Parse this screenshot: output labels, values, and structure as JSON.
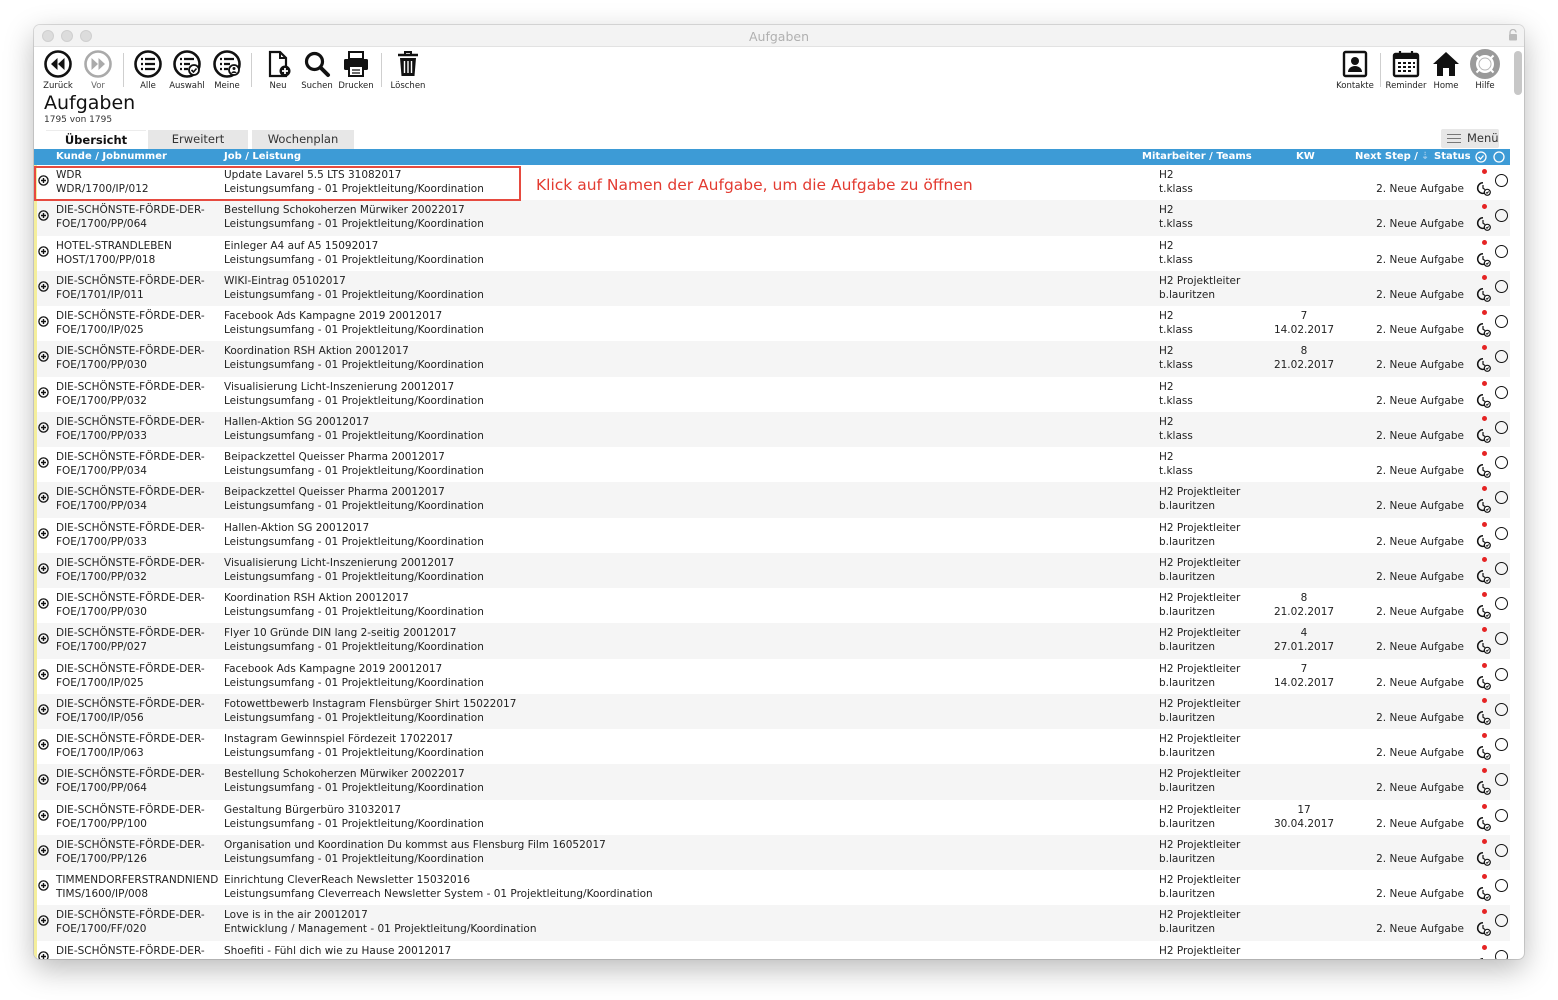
{
  "window": {
    "title": "Aufgaben"
  },
  "toolbar": {
    "left": [
      {
        "label": "Zurück",
        "icon": "back-icon"
      },
      {
        "label": "Vor",
        "icon": "forward-icon"
      },
      {
        "label": "Alle",
        "icon": "list-all-icon"
      },
      {
        "label": "Auswahl",
        "icon": "list-selection-icon"
      },
      {
        "label": "Meine",
        "icon": "list-mine-icon"
      },
      {
        "label": "Neu",
        "icon": "new-document-icon"
      },
      {
        "label": "Suchen",
        "icon": "search-icon"
      },
      {
        "label": "Drucken",
        "icon": "printer-icon"
      },
      {
        "label": "Löschen",
        "icon": "trash-icon"
      }
    ],
    "right": [
      {
        "label": "Kontakte",
        "icon": "contacts-icon"
      },
      {
        "label": "Reminder",
        "icon": "calendar-icon"
      },
      {
        "label": "Home",
        "icon": "home-icon"
      },
      {
        "label": "Hilfe",
        "icon": "help-icon"
      }
    ]
  },
  "page": {
    "title": "Aufgaben",
    "count": "1795 von 1795"
  },
  "tabs": [
    {
      "label": "Übersicht",
      "active": true
    },
    {
      "label": "Erweitert",
      "active": false
    },
    {
      "label": "Wochenplan",
      "active": false
    }
  ],
  "menu_label": "Menü",
  "columns": {
    "kunde": "Kunde / Jobnummer",
    "job": "Job / Leistung",
    "mitarbeiter": "Mitarbeiter / Teams",
    "kw": "KW",
    "next": "Next Step / ",
    "status": "Status"
  },
  "colors": {
    "header": "#3d9bd6",
    "stripe": "#f4ee9c",
    "highlight": "#e64a3f",
    "dot": "#e52424"
  },
  "annotation": "Klick auf Namen der Aufgabe, um die Aufgabe zu öffnen",
  "rows": [
    {
      "kunde": "WDR",
      "jobnr": "WDR/1700/IP/012",
      "job": "Update Lavarel 5.5 LTS 31082017",
      "leistung": "Leistungsumfang - 01 Projektleitung/Koordination",
      "team": "H2",
      "mitarbeiter": "t.klass",
      "kw": "",
      "datum": "",
      "next": "2. Neue Aufgabe"
    },
    {
      "kunde": "DIE-SCHÖNSTE-FÖRDE-DER-",
      "jobnr": "FOE/1700/PP/064",
      "job": "Bestellung Schokoherzen Mürwiker 20022017",
      "leistung": "Leistungsumfang - 01 Projektleitung/Koordination",
      "team": "H2",
      "mitarbeiter": "t.klass",
      "kw": "",
      "datum": "",
      "next": "2. Neue Aufgabe"
    },
    {
      "kunde": "HOTEL-STRANDLEBEN",
      "jobnr": "HOST/1700/PP/018",
      "job": "Einleger A4 auf A5 15092017",
      "leistung": "Leistungsumfang - 01 Projektleitung/Koordination",
      "team": "H2",
      "mitarbeiter": "t.klass",
      "kw": "",
      "datum": "",
      "next": "2. Neue Aufgabe"
    },
    {
      "kunde": "DIE-SCHÖNSTE-FÖRDE-DER-",
      "jobnr": "FOE/1701/IP/011",
      "job": "WIKI-Eintrag 05102017",
      "leistung": "Leistungsumfang - 01 Projektleitung/Koordination",
      "team": "H2 Projektleiter",
      "mitarbeiter": "b.lauritzen",
      "kw": "",
      "datum": "",
      "next": "2. Neue Aufgabe"
    },
    {
      "kunde": "DIE-SCHÖNSTE-FÖRDE-DER-",
      "jobnr": "FOE/1700/IP/025",
      "job": "Facebook Ads Kampagne 2019 20012017",
      "leistung": "Leistungsumfang - 01 Projektleitung/Koordination",
      "team": "H2",
      "mitarbeiter": "t.klass",
      "kw": "7",
      "datum": "14.02.2017",
      "next": "2. Neue Aufgabe"
    },
    {
      "kunde": "DIE-SCHÖNSTE-FÖRDE-DER-",
      "jobnr": "FOE/1700/PP/030",
      "job": "Koordination RSH Aktion 20012017",
      "leistung": "Leistungsumfang - 01 Projektleitung/Koordination",
      "team": "H2",
      "mitarbeiter": "t.klass",
      "kw": "8",
      "datum": "21.02.2017",
      "next": "2. Neue Aufgabe"
    },
    {
      "kunde": "DIE-SCHÖNSTE-FÖRDE-DER-",
      "jobnr": "FOE/1700/PP/032",
      "job": "Visualisierung Licht-Inszenierung 20012017",
      "leistung": "Leistungsumfang - 01 Projektleitung/Koordination",
      "team": "H2",
      "mitarbeiter": "t.klass",
      "kw": "",
      "datum": "",
      "next": "2. Neue Aufgabe"
    },
    {
      "kunde": "DIE-SCHÖNSTE-FÖRDE-DER-",
      "jobnr": "FOE/1700/PP/033",
      "job": "Hallen-Aktion SG 20012017",
      "leistung": "Leistungsumfang - 01 Projektleitung/Koordination",
      "team": "H2",
      "mitarbeiter": "t.klass",
      "kw": "",
      "datum": "",
      "next": "2. Neue Aufgabe"
    },
    {
      "kunde": "DIE-SCHÖNSTE-FÖRDE-DER-",
      "jobnr": "FOE/1700/PP/034",
      "job": "Beipackzettel Queisser Pharma 20012017",
      "leistung": "Leistungsumfang - 01 Projektleitung/Koordination",
      "team": "H2",
      "mitarbeiter": "t.klass",
      "kw": "",
      "datum": "",
      "next": "2. Neue Aufgabe"
    },
    {
      "kunde": "DIE-SCHÖNSTE-FÖRDE-DER-",
      "jobnr": "FOE/1700/PP/034",
      "job": "Beipackzettel Queisser Pharma 20012017",
      "leistung": "Leistungsumfang - 01 Projektleitung/Koordination",
      "team": "H2 Projektleiter",
      "mitarbeiter": "b.lauritzen",
      "kw": "",
      "datum": "",
      "next": "2. Neue Aufgabe"
    },
    {
      "kunde": "DIE-SCHÖNSTE-FÖRDE-DER-",
      "jobnr": "FOE/1700/PP/033",
      "job": "Hallen-Aktion SG 20012017",
      "leistung": "Leistungsumfang - 01 Projektleitung/Koordination",
      "team": "H2 Projektleiter",
      "mitarbeiter": "b.lauritzen",
      "kw": "",
      "datum": "",
      "next": "2. Neue Aufgabe"
    },
    {
      "kunde": "DIE-SCHÖNSTE-FÖRDE-DER-",
      "jobnr": "FOE/1700/PP/032",
      "job": "Visualisierung Licht-Inszenierung 20012017",
      "leistung": "Leistungsumfang - 01 Projektleitung/Koordination",
      "team": "H2 Projektleiter",
      "mitarbeiter": "b.lauritzen",
      "kw": "",
      "datum": "",
      "next": "2. Neue Aufgabe"
    },
    {
      "kunde": "DIE-SCHÖNSTE-FÖRDE-DER-",
      "jobnr": "FOE/1700/PP/030",
      "job": "Koordination RSH Aktion 20012017",
      "leistung": "Leistungsumfang - 01 Projektleitung/Koordination",
      "team": "H2 Projektleiter",
      "mitarbeiter": "b.lauritzen",
      "kw": "8",
      "datum": "21.02.2017",
      "next": "2. Neue Aufgabe"
    },
    {
      "kunde": "DIE-SCHÖNSTE-FÖRDE-DER-",
      "jobnr": "FOE/1700/PP/027",
      "job": "Flyer 10 Gründe DIN lang 2-seitig 20012017",
      "leistung": "Leistungsumfang - 01 Projektleitung/Koordination",
      "team": "H2 Projektleiter",
      "mitarbeiter": "b.lauritzen",
      "kw": "4",
      "datum": "27.01.2017",
      "next": "2. Neue Aufgabe"
    },
    {
      "kunde": "DIE-SCHÖNSTE-FÖRDE-DER-",
      "jobnr": "FOE/1700/IP/025",
      "job": "Facebook Ads Kampagne 2019 20012017",
      "leistung": "Leistungsumfang - 01 Projektleitung/Koordination",
      "team": "H2 Projektleiter",
      "mitarbeiter": "b.lauritzen",
      "kw": "7",
      "datum": "14.02.2017",
      "next": "2. Neue Aufgabe"
    },
    {
      "kunde": "DIE-SCHÖNSTE-FÖRDE-DER-",
      "jobnr": "FOE/1700/IP/056",
      "job": "Fotowettbewerb Instagram Flensbürger Shirt 15022017",
      "leistung": "Leistungsumfang - 01 Projektleitung/Koordination",
      "team": "H2 Projektleiter",
      "mitarbeiter": "b.lauritzen",
      "kw": "",
      "datum": "",
      "next": "2. Neue Aufgabe"
    },
    {
      "kunde": "DIE-SCHÖNSTE-FÖRDE-DER-",
      "jobnr": "FOE/1700/IP/063",
      "job": "Instagram Gewinnspiel Fördezeit 17022017",
      "leistung": "Leistungsumfang - 01 Projektleitung/Koordination",
      "team": "H2 Projektleiter",
      "mitarbeiter": "b.lauritzen",
      "kw": "",
      "datum": "",
      "next": "2. Neue Aufgabe"
    },
    {
      "kunde": "DIE-SCHÖNSTE-FÖRDE-DER-",
      "jobnr": "FOE/1700/PP/064",
      "job": "Bestellung Schokoherzen Mürwiker 20022017",
      "leistung": "Leistungsumfang - 01 Projektleitung/Koordination",
      "team": "H2 Projektleiter",
      "mitarbeiter": "b.lauritzen",
      "kw": "",
      "datum": "",
      "next": "2. Neue Aufgabe"
    },
    {
      "kunde": "DIE-SCHÖNSTE-FÖRDE-DER-",
      "jobnr": "FOE/1700/PP/100",
      "job": "Gestaltung Bürgerbüro 31032017",
      "leistung": "Leistungsumfang - 01 Projektleitung/Koordination",
      "team": "H2 Projektleiter",
      "mitarbeiter": "b.lauritzen",
      "kw": "17",
      "datum": "30.04.2017",
      "next": "2. Neue Aufgabe"
    },
    {
      "kunde": "DIE-SCHÖNSTE-FÖRDE-DER-",
      "jobnr": "FOE/1700/PP/126",
      "job": "Organisation und Koordination Du kommst aus Flensburg Film 16052017",
      "leistung": "Leistungsumfang - 01 Projektleitung/Koordination",
      "team": "H2 Projektleiter",
      "mitarbeiter": "b.lauritzen",
      "kw": "",
      "datum": "",
      "next": "2. Neue Aufgabe"
    },
    {
      "kunde": "TIMMENDORFERSTRANDNIEND",
      "jobnr": "TIMS/1600/IP/008",
      "job": "Einrichtung CleverReach Newsletter 15032016",
      "leistung": "Leistungsumfang Cleverreach Newsletter System - 01 Projektleitung/Koordination",
      "team": "H2 Projektleiter",
      "mitarbeiter": "b.lauritzen",
      "kw": "",
      "datum": "",
      "next": "2. Neue Aufgabe"
    },
    {
      "kunde": "DIE-SCHÖNSTE-FÖRDE-DER-",
      "jobnr": "FOE/1700/FF/020",
      "job": "Love is in the air 20012017",
      "leistung": "Entwicklung / Management - 01 Projektleitung/Koordination",
      "team": "H2 Projektleiter",
      "mitarbeiter": "b.lauritzen",
      "kw": "",
      "datum": "",
      "next": "2. Neue Aufgabe"
    },
    {
      "kunde": "DIE-SCHÖNSTE-FÖRDE-DER-",
      "jobnr": "",
      "job": "Shoefiti - Fühl dich wie zu Hause 20012017",
      "leistung": "",
      "team": "H2 Projektleiter",
      "mitarbeiter": "",
      "kw": "",
      "datum": "",
      "next": ""
    }
  ]
}
